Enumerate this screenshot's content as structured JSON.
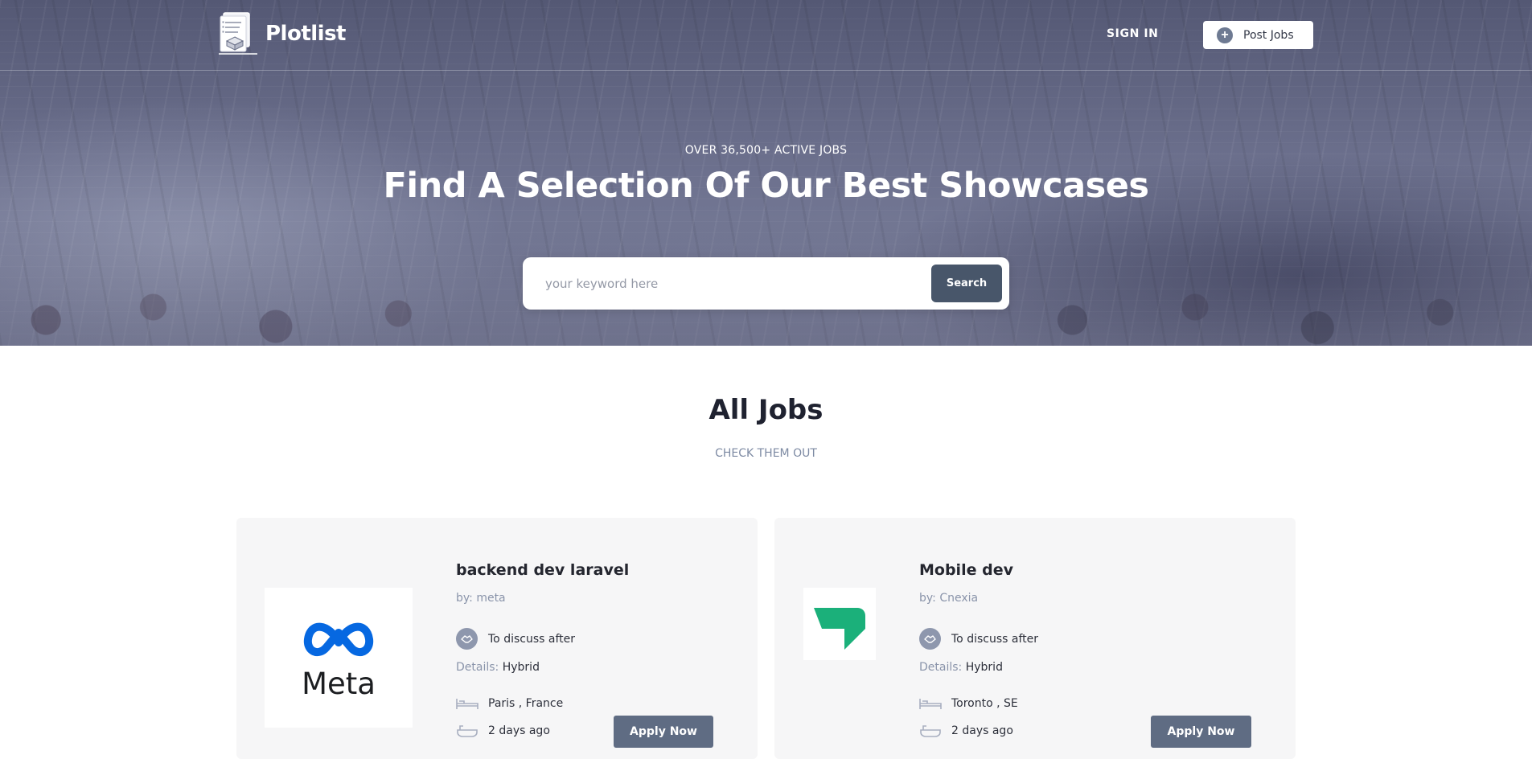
{
  "brand": {
    "name": "Plotlist"
  },
  "nav": {
    "sign_in": "SIGN IN",
    "post_jobs": "Post Jobs"
  },
  "hero": {
    "kicker": "OVER 36,500+ ACTIVE JOBS",
    "title": "Find A Selection Of Our Best Showcases",
    "search_placeholder": "your keyword here",
    "search_button": "Search"
  },
  "jobs_section": {
    "title": "All Jobs",
    "subtitle": "CHECK THEM OUT"
  },
  "jobs": [
    {
      "title": "backend dev laravel",
      "company": "by: meta",
      "logo_text": "Meta",
      "salary": "To discuss after",
      "details_label": "Details:",
      "details_value": "Hybrid",
      "location": "Paris , France",
      "posted": "2 days ago",
      "apply": "Apply Now"
    },
    {
      "title": "Mobile dev",
      "company": "by: Cnexia",
      "salary": "To discuss after",
      "details_label": "Details:",
      "details_value": "Hybrid",
      "location": "Toronto , SE",
      "posted": "2 days ago",
      "apply": "Apply Now"
    }
  ],
  "colors": {
    "hero_overlay": "#6b6f8c",
    "search_button": "#48566a",
    "apply_button": "#5f6c83",
    "muted_text": "#8a94aa",
    "meta_blue": "#0668E1",
    "cnexia_green": "#1bb07a"
  },
  "icons": {
    "logo": "document-stack-icon",
    "post_jobs": "plus-circle-icon",
    "salary": "handshake-icon",
    "location": "bed-icon",
    "posted": "bathtub-icon"
  }
}
